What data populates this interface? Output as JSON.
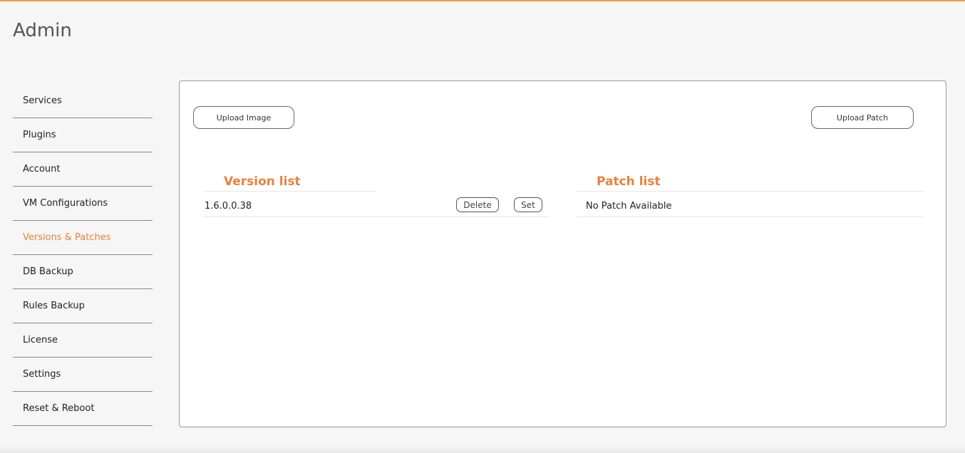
{
  "header": {
    "title": "Admin"
  },
  "sidebar": {
    "items": [
      {
        "label": "Services"
      },
      {
        "label": "Plugins"
      },
      {
        "label": "Account"
      },
      {
        "label": "VM Configurations"
      },
      {
        "label": "Versions & Patches"
      },
      {
        "label": "DB Backup"
      },
      {
        "label": "Rules Backup"
      },
      {
        "label": "License"
      },
      {
        "label": "Settings"
      },
      {
        "label": "Reset & Reboot"
      }
    ],
    "active": "Versions & Patches"
  },
  "main": {
    "upload_image_label": "Upload Image",
    "upload_patch_label": "Upload Patch",
    "version_list": {
      "title": "Version list",
      "rows": [
        {
          "version": "1.6.0.0.38",
          "delete_label": "Delete",
          "set_label": "Set"
        }
      ]
    },
    "patch_list": {
      "title": "Patch list",
      "empty_text": "No Patch Available"
    }
  },
  "colors": {
    "accent": "#e8813a",
    "top_line": "#e8a04a"
  }
}
